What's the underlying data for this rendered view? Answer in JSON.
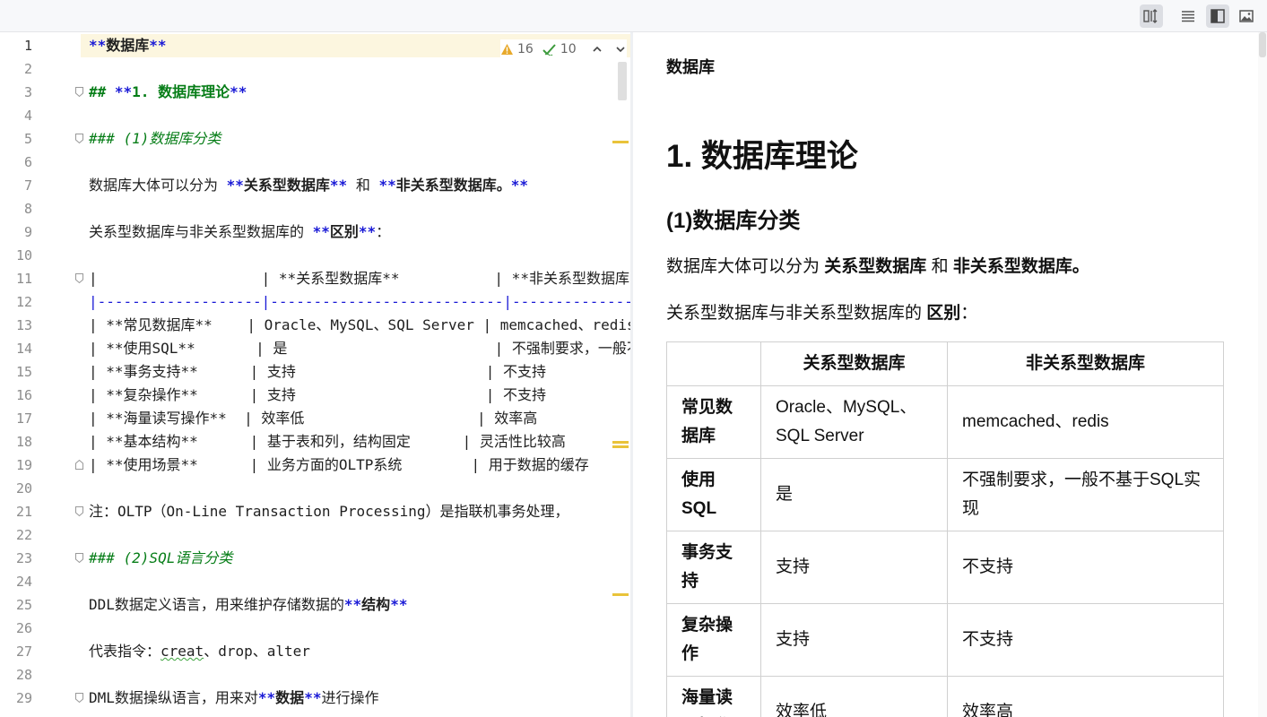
{
  "toolbar": {
    "buttons": [
      {
        "name": "editor-and-preview-sync",
        "icon": "columns-sync-icon",
        "active": true
      },
      {
        "name": "editor-only",
        "icon": "lines-icon",
        "active": false
      },
      {
        "name": "split-view",
        "icon": "split-view-icon",
        "active": true
      },
      {
        "name": "preview-only",
        "icon": "image-icon",
        "active": false
      }
    ]
  },
  "inspections": {
    "warnings": "16",
    "typos": "10"
  },
  "editor": {
    "line_numbers": [
      "1",
      "2",
      "3",
      "4",
      "5",
      "6",
      "7",
      "8",
      "9",
      "10",
      "11",
      "12",
      "13",
      "14",
      "15",
      "16",
      "17",
      "18",
      "19",
      "20",
      "21",
      "22",
      "23",
      "24",
      "25",
      "26",
      "27",
      "28",
      "29"
    ],
    "lines": {
      "l1_mark_open": "**",
      "l1_text": "数据库",
      "l1_mark_close": "**",
      "l3_hash": "## ",
      "l3_mark_open": "**",
      "l3_text": "1. 数据库理论",
      "l3_mark_close": "**",
      "l5_hash": "### ",
      "l5_text": "(1)数据库分类",
      "l7_a": "数据库大体可以分为 ",
      "l7_b": "关系型数据库",
      "l7_c": " 和 ",
      "l7_d": "非关系型数据库。",
      "l9_a": "关系型数据库与非关系型数据库的 ",
      "l9_b": "区别",
      "l9_c": "：",
      "l11": "|                   | **关系型数据库**           | **非关系型数据库**",
      "l12": "|-------------------|---------------------------|-----------------",
      "l13": "| **常见数据库**    | Oracle、MySQL、SQL Server | memcached、redis",
      "l14": "| **使用SQL**       | 是                        | 不强制要求，一般不基于SQL实现",
      "l15": "| **事务支持**      | 支持                      | 不支持",
      "l16": "| **复杂操作**      | 支持                      | 不支持",
      "l17": "| **海量读写操作**  | 效率低                    | 效率高",
      "l18": "| **基本结构**      | 基于表和列，结构固定      | 灵活性比较高",
      "l19": "| **使用场景**      | 业务方面的OLTP系统        | 用于数据的缓存",
      "l21": "注：OLTP（On-Line Transaction Processing）是指联机事务处理，",
      "l23_hash": "### ",
      "l23_text": "(2)SQL语言分类",
      "l25_a": "DDL数据定义语言，用来维护存储数据的",
      "l25_b": "结构",
      "l27_a": "代表指令：",
      "l27_b": "creat",
      "l27_c": "、drop、alter",
      "l29_a": "DML数据操纵语言，用来对",
      "l29_b": "数据",
      "l29_c": "进行操作"
    }
  },
  "preview": {
    "title": "数据库",
    "h1": "1. 数据库理论",
    "h2": "(1)数据库分类",
    "para1_a": "数据库大体可以分为 ",
    "para1_b": "关系型数据库",
    "para1_c": " 和 ",
    "para1_d": "非关系型数据库。",
    "para2_a": "关系型数据库与非关系型数据库的 ",
    "para2_b": "区别",
    "para2_c": "：",
    "table": {
      "headers": [
        "",
        "关系型数据库",
        "非关系型数据库"
      ],
      "rows": [
        [
          "常见数据库",
          "Oracle、MySQL、SQL Server",
          "memcached、redis"
        ],
        [
          "使用SQL",
          "是",
          "不强制要求，一般不基于SQL实现"
        ],
        [
          "事务支持",
          "支持",
          "不支持"
        ],
        [
          "复杂操作",
          "支持",
          "不支持"
        ],
        [
          "海量读写操作",
          "效率低",
          "效率高"
        ]
      ]
    }
  }
}
